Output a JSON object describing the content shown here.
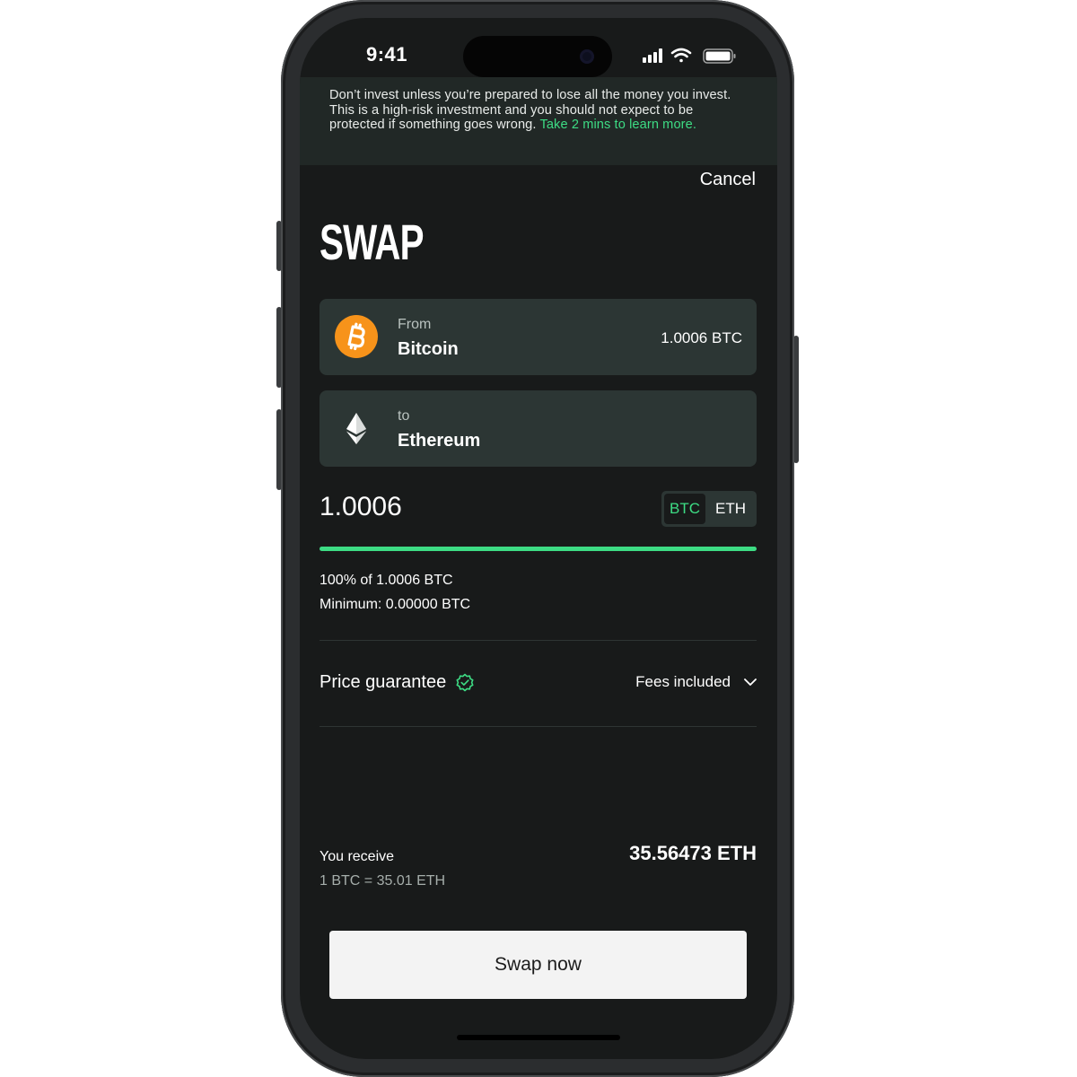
{
  "status_bar": {
    "time": "9:41"
  },
  "warning": {
    "text": "Don’t invest unless you’re prepared to lose all the money you invest. This is a high-risk investment and you should not expect to be protected if something goes wrong. ",
    "link_text": "Take 2 mins to learn more."
  },
  "header": {
    "cancel_label": "Cancel",
    "title": "SWAP"
  },
  "from_asset": {
    "label": "From",
    "name": "Bitcoin",
    "balance": "1.0006 BTC",
    "icon": "bitcoin-icon",
    "color": "#f7931a"
  },
  "to_asset": {
    "label": "to",
    "name": "Ethereum",
    "icon": "ethereum-icon"
  },
  "amount": {
    "value": "1.0006",
    "units": [
      "BTC",
      "ETH"
    ],
    "active_unit": "BTC",
    "slider_percent": 100
  },
  "details": {
    "percent_line": "100% of 1.0006 BTC",
    "minimum_line": "Minimum: 0.00000 BTC",
    "price_guarantee_label": "Price guarantee",
    "fees_label": "Fees included"
  },
  "receive": {
    "label": "You receive",
    "rate": "1 BTC = 35.01 ETH",
    "amount": "35.56473 ETH"
  },
  "actions": {
    "swap_label": "Swap now"
  },
  "colors": {
    "accent": "#3ddc84",
    "background": "#181a1a",
    "card": "#2c3634"
  }
}
